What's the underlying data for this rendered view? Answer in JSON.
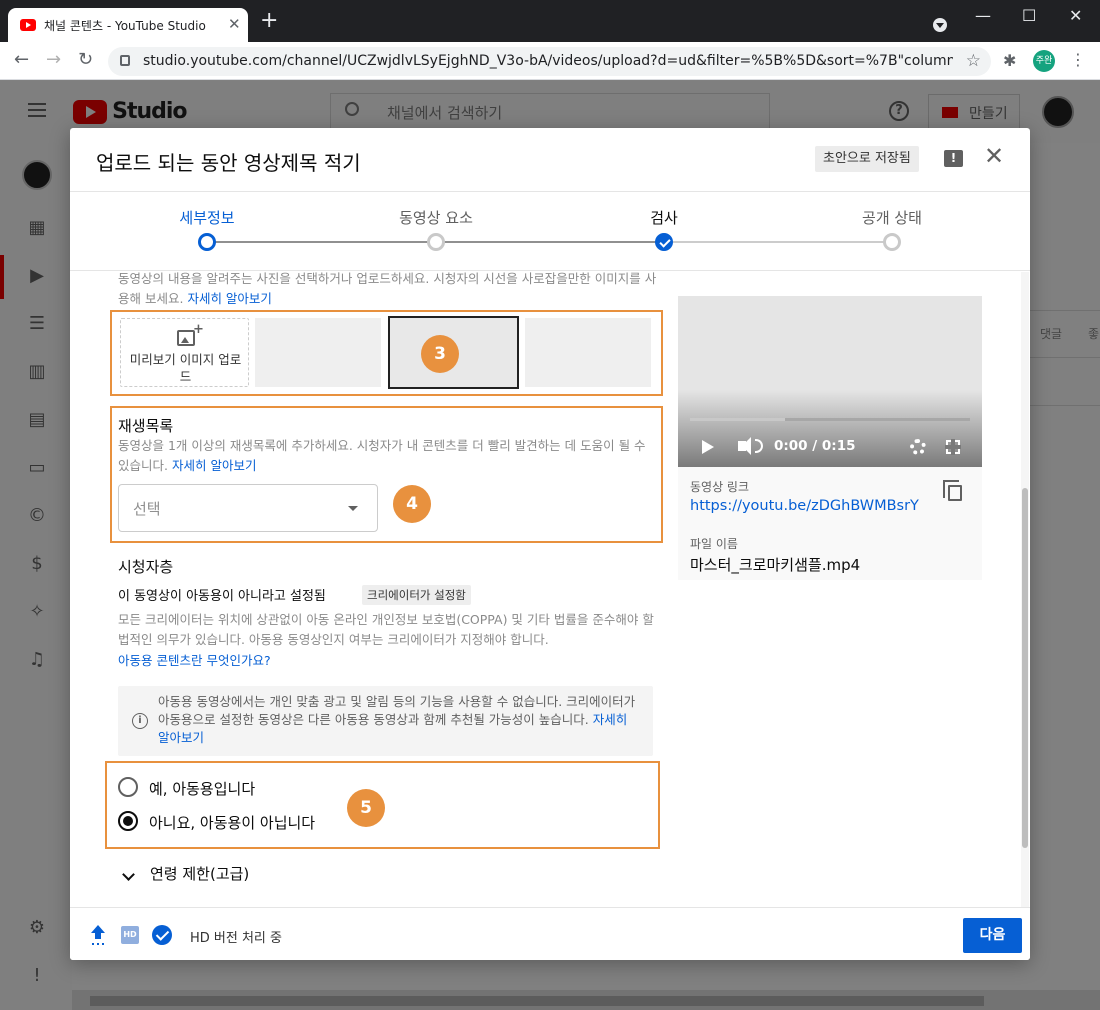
{
  "browser": {
    "tab_title": "채널 콘텐츠 - YouTube Studio",
    "tab_close": "✕",
    "new_tab": "+",
    "url": "studio.youtube.com/channel/UCZwjdlvLSyEjghND_V3o-bA/videos/upload?d=ud&filter=%5B%5D&sort=%7B\"columnType\"%3...",
    "profile_initials": "주완",
    "back": "←",
    "forward": "→",
    "reload": "↻",
    "star": "☆",
    "ext": "✱",
    "menu": "⋮",
    "win_min": "—",
    "win_max": "☐",
    "win_close": "✕"
  },
  "studio": {
    "logo_text": "Studio",
    "search_placeholder": "채널에서 검색하기",
    "create_label": "만들기",
    "help_label": "?",
    "bg_col1": "댓글",
    "bg_col2": "좋"
  },
  "modal": {
    "title": "업로드 되는 동안 영상제목 적기",
    "draft_label": "초안으로 저장됨",
    "feedback_label": "!",
    "close_label": "✕",
    "steps": [
      {
        "label": "세부정보",
        "state": "active"
      },
      {
        "label": "동영상 요소",
        "state": "idle"
      },
      {
        "label": "검사",
        "state": "done"
      },
      {
        "label": "공개 상태",
        "state": "idle"
      }
    ],
    "thumbnail": {
      "desc": "동영상의 내용을 알려주는 사진을 선택하거나 업로드하세요. 시청자의 시선을 사로잡을만한 이미지를 사용해 보세요.",
      "link": "자세히 알아보기",
      "upload_label": "미리보기 이미지 업로드",
      "badge": "3"
    },
    "playlist": {
      "title": "재생목록",
      "desc": "동영상을 1개 이상의 재생목록에 추가하세요. 시청자가 내 콘텐츠를 더 빨리 발견하는 데 도움이 될 수 있습니다.",
      "link": "자세히 알아보기",
      "select_value": "선택",
      "badge": "4"
    },
    "audience": {
      "title": "시청자층",
      "status": "이 동영상이 아동용이 아니라고 설정됨",
      "chip": "크리에이터가 설정함",
      "desc": "모든 크리에이터는 위치에 상관없이 아동 온라인 개인정보 보호법(COPPA) 및 기타 법률을 준수해야 할 법적인 의무가 있습니다. 아동용 동영상인지 여부는 크리에이터가 지정해야 합니다.",
      "link": "아동용 콘텐츠란 무엇인가요?",
      "info_text": "아동용 동영상에서는 개인 맞춤 광고 및 알림 등의 기능을 사용할 수 없습니다. 크리에이터가 아동용으로 설정한 동영상은 다른 아동용 동영상과 함께 추천될 가능성이 높습니다.",
      "info_link": "자세히 알아보기",
      "info_icon": "i",
      "option_yes": "예, 아동용입니다",
      "option_no": "아니요, 아동용이 아닙니다",
      "selected": "no",
      "badge": "5"
    },
    "age_restriction": "연령 제한(고급)",
    "video": {
      "time": "0:00 / 0:15",
      "progress": 0.34,
      "link_label": "동영상 링크",
      "link": "https://youtu.be/zDGhBWMBsrY",
      "file_label": "파일 이름",
      "file_name": "마스터_크로마키샘플.mp4"
    },
    "footer": {
      "hd_label": "HD",
      "status": "HD 버전 처리 중",
      "next_label": "다음"
    }
  },
  "colors": {
    "accent": "#065fd4",
    "highlight": "#e8913e",
    "brand_red": "#ff0000"
  }
}
